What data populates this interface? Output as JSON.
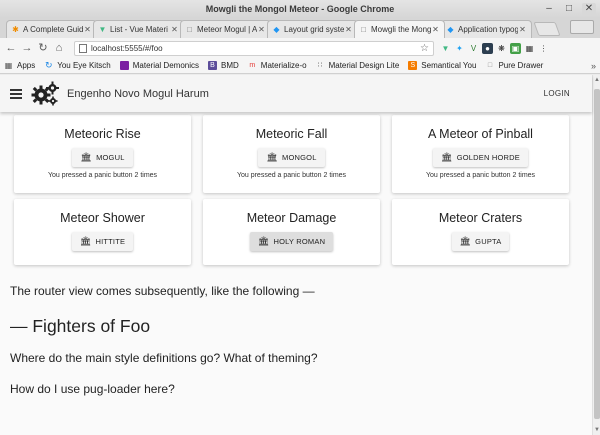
{
  "window": {
    "title": "Mowgli the Mongol Meteor - Google Chrome"
  },
  "tabs": [
    {
      "label": "A Complete Guid",
      "icon": "orange-star-icon",
      "active": false
    },
    {
      "label": "List - Vue Materi",
      "icon": "vue-icon",
      "active": false
    },
    {
      "label": "Meteor Mogul | A",
      "icon": "page-icon",
      "active": false
    },
    {
      "label": "Layout grid syste",
      "icon": "blue-drop-icon",
      "active": false
    },
    {
      "label": "Mowgli the Mong",
      "icon": "page-icon",
      "active": true
    },
    {
      "label": "Application typog",
      "icon": "blue-drop-icon",
      "active": false
    }
  ],
  "toolbar": {
    "url": "localhost:5555/#/foo"
  },
  "bookmarks": [
    {
      "label": "Apps",
      "icon": "apps-grid-icon",
      "color": "#555555"
    },
    {
      "label": "You Eye Kitsch",
      "icon": "refresh-icon",
      "color": "#1e88e5"
    },
    {
      "label": "Material Demonics",
      "icon": "purple-square-icon",
      "color": "#7b1fa2"
    },
    {
      "label": "BMD",
      "icon": "b-icon",
      "color": "#5c4d9a"
    },
    {
      "label": "Materialize-o",
      "icon": "materialize-icon",
      "color": "#e53935"
    },
    {
      "label": "Material Design Lite",
      "icon": "dots-icon",
      "color": "#333333"
    },
    {
      "label": "Semantical You",
      "icon": "orange-icon",
      "color": "#f57c00"
    },
    {
      "label": "Pure Drawer",
      "icon": "page-icon",
      "color": "#888888"
    }
  ],
  "appbar": {
    "title": "Engenho Novo Mogul Harum",
    "login": "LOGIN"
  },
  "cards": [
    {
      "title": "Meteoric Rise",
      "button": "MOGUL",
      "status": "You pressed a panic button 2 times"
    },
    {
      "title": "Meteoric Fall",
      "button": "MONGOL",
      "status": "You pressed a panic button 2 times"
    },
    {
      "title": "A Meteor of Pinball",
      "button": "GOLDEN HORDE",
      "status": "You pressed a panic button 2 times"
    },
    {
      "title": "Meteor Shower",
      "button": "HITTITE",
      "status": ""
    },
    {
      "title": "Meteor Damage",
      "button": "HOLY ROMAN",
      "status": ""
    },
    {
      "title": "Meteor Craters",
      "button": "GUPTA",
      "status": ""
    }
  ],
  "content": {
    "intro": "The router view comes subsequently, like the following —",
    "heading": "— Fighters of Foo",
    "question1": "Where do the main style definitions go? What of theming?",
    "question2": "How do I use pug-loader here?"
  },
  "colors": {
    "appbar_bg": "#f5f5f5",
    "card_bg": "#ffffff",
    "page_bg": "#fafafa"
  }
}
